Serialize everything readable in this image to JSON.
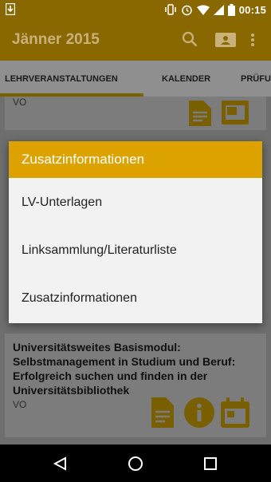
{
  "status_bar": {
    "time": "00:15",
    "left_icon": "download-icon",
    "right_icons": [
      "vibrate-icon",
      "alarm-icon",
      "wifi-icon",
      "signal-icon",
      "battery-icon"
    ]
  },
  "app_bar": {
    "title": "Jänner 2015",
    "icons": [
      "search-icon",
      "contact-card-icon",
      "more-vert-icon"
    ]
  },
  "tabs": [
    {
      "label": "LEHRVERANSTALTUNGEN",
      "selected": true
    },
    {
      "label": "KALENDER",
      "selected": false
    },
    {
      "label": "PRÜFU",
      "selected": false
    }
  ],
  "cards": [
    {
      "type_partial": "VO",
      "icons": [
        "document-icon",
        "window-icon"
      ]
    },
    {
      "title": "Universitätsweites Basismodul: Selbstmanagement in Studium und Beruf: Erfolgreich suchen und finden in der Universitätsbibliothek",
      "type": "VO",
      "icons": [
        "document-icon",
        "info-icon",
        "calendar-icon"
      ]
    }
  ],
  "dialog": {
    "title": "Zusatzinformationen",
    "items": [
      "LV-Unterlagen",
      "Linksammlung/Literaturliste",
      "Zusatzinformationen"
    ]
  },
  "colors": {
    "app_bar": "#8a6800",
    "dialog_header": "#dca300",
    "icon_accent": "#7a5f00"
  },
  "nav_bar": {
    "icons": [
      "back-icon",
      "home-icon",
      "recents-icon"
    ]
  }
}
